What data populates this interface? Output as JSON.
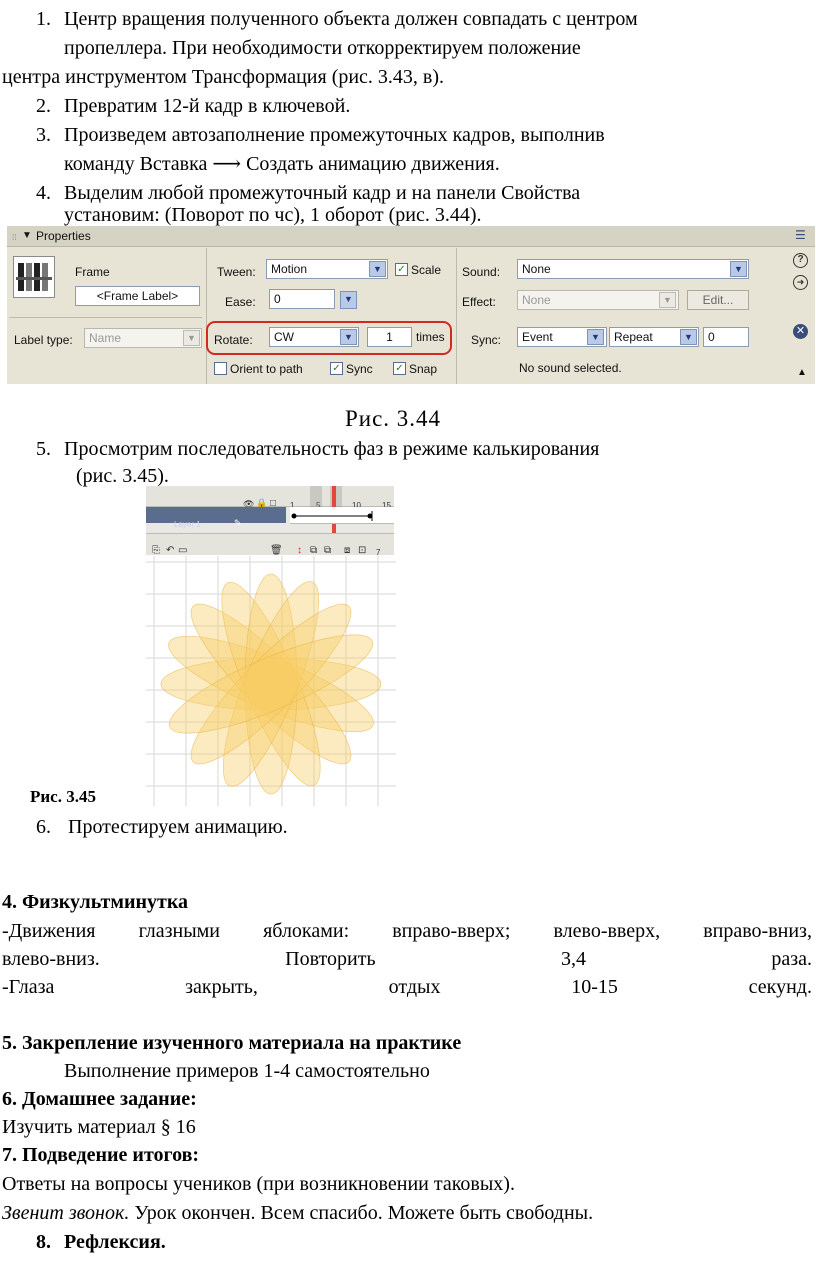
{
  "steps_top": [
    {
      "num": "1.",
      "line1": "Центр вращения полученного объекта должен совпадать с центром",
      "line2": "пропеллера. При необходимости откорректируем положение",
      "line3": "центра инструментом Трансформация (рис. 3.43, в)."
    },
    {
      "num": "2.",
      "line1": "Превратим 12-й кадр в ключевой."
    },
    {
      "num": "3.",
      "line1": "Произведем автозаполнение промежуточных кадров, выполнив",
      "line2": "команду Вставка ⟶ Создать анимацию движения."
    },
    {
      "num": "4.",
      "line1": "Выделим любой промежуточный кадр и на панели Свойства",
      "line2": "установим: (Поворот по чс), 1 оборот (рис. 3.44)."
    }
  ],
  "properties_panel": {
    "title": "Properties",
    "frame_label": "Frame",
    "frame_label_field": "<Frame Label>",
    "label_type_label": "Label type:",
    "label_type_value": "Name",
    "tween_label": "Tween:",
    "tween_value": "Motion",
    "scale_label": "Scale",
    "ease_label": "Ease:",
    "ease_value": "0",
    "rotate_label": "Rotate:",
    "rotate_value": "CW",
    "times_value": "1",
    "times_label": "times",
    "orient_label": "Orient to path",
    "sync_cb_label": "Sync",
    "snap_label": "Snap",
    "sound_label": "Sound:",
    "sound_value": "None",
    "effect_label": "Effect:",
    "effect_value": "None",
    "edit_button": "Edit...",
    "sync_label": "Sync:",
    "sync_value": "Event",
    "repeat_value": "Repeat",
    "repeat_count": "0",
    "no_sound": "No sound selected.",
    "highlight_color": "#d22a1f"
  },
  "fig344_caption": "Рис. 3.44",
  "step5": {
    "num": "5.",
    "line1": "Просмотрим последовательность фаз в режиме калькирования",
    "line2": "(рис. 3.45)."
  },
  "timeline": {
    "layer": "Layer 1",
    "tick1": "1",
    "tick5": "5",
    "tick10": "10",
    "tick15": "15",
    "value7": "7"
  },
  "fig345_caption": "Рис. 3.45",
  "step6": {
    "num": "6.",
    "text": "Протестируем анимацию."
  },
  "section4": {
    "title": "4. Физкультминутка",
    "line1_words": [
      "-Движения",
      "глазными",
      "яблоками:",
      "вправо-вверх;",
      "влево-вверх,",
      "вправо-вниз,"
    ],
    "line2_words": [
      "влево-вниз.",
      "Повторить",
      "3,4",
      "раза."
    ],
    "line3_words": [
      "-Глаза",
      "закрыть,",
      "отдых",
      "10-15",
      "секунд."
    ]
  },
  "section5": {
    "title": "5. Закрепление изученного материала на практике",
    "text": "Выполнение примеров 1-4 самостоятельно"
  },
  "section6": {
    "title": "6.  Домашнее задание:",
    "text": "Изучить материал § 16"
  },
  "section7": {
    "title": "7.  Подведение итогов:",
    "text": "Ответы на вопросы учеников (при возникновении таковых).",
    "italic": "Звенит звонок.",
    "rest": " Урок окончен. Всем спасибо. Можете быть свободны."
  },
  "section8": {
    "num": "8.",
    "title": "Рефлексия."
  },
  "colors": {
    "petal_fill": "#f7cc63",
    "grid": "#d7d7d7",
    "panel_bg": "#e7e4d6"
  }
}
